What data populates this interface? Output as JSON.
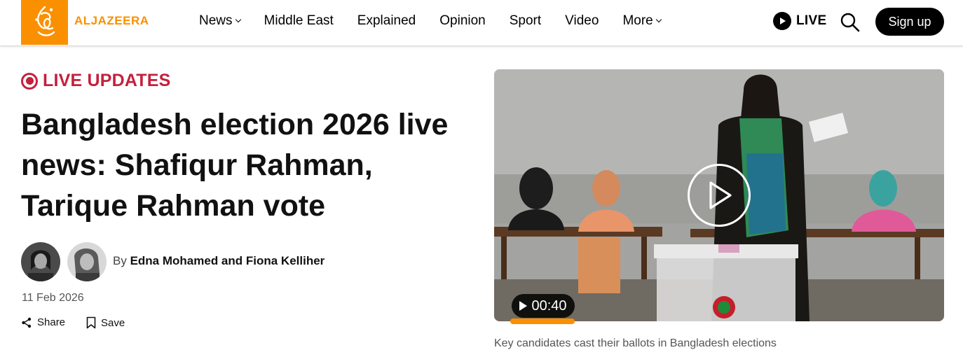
{
  "header": {
    "logo_text": "ALJAZEERA",
    "nav": [
      {
        "label": "News",
        "has_dropdown": true
      },
      {
        "label": "Middle East",
        "has_dropdown": false
      },
      {
        "label": "Explained",
        "has_dropdown": false
      },
      {
        "label": "Opinion",
        "has_dropdown": false
      },
      {
        "label": "Sport",
        "has_dropdown": false
      },
      {
        "label": "Video",
        "has_dropdown": false
      },
      {
        "label": "More",
        "has_dropdown": true
      }
    ],
    "live_label": "LIVE",
    "signup_label": "Sign up"
  },
  "article": {
    "live_badge": "LIVE UPDATES",
    "title": "Bangladesh election 2026 live news: Shafiqur Rahman, Tarique Rahman vote",
    "byline_prefix": "By",
    "authors": "Edna Mohamed and Fiona Kelliher",
    "date": "11 Feb 2026",
    "share_label": "Share",
    "save_label": "Save"
  },
  "media": {
    "duration": "00:40",
    "caption": "Key candidates cast their ballots in Bangladesh elections"
  },
  "colors": {
    "brand": "#fa9000",
    "live_red": "#c4203d",
    "text": "#111111"
  },
  "icons": [
    "logo-icon",
    "chevron-down-icon",
    "play-icon",
    "search-icon",
    "live-dot-icon",
    "share-icon",
    "bookmark-icon"
  ]
}
